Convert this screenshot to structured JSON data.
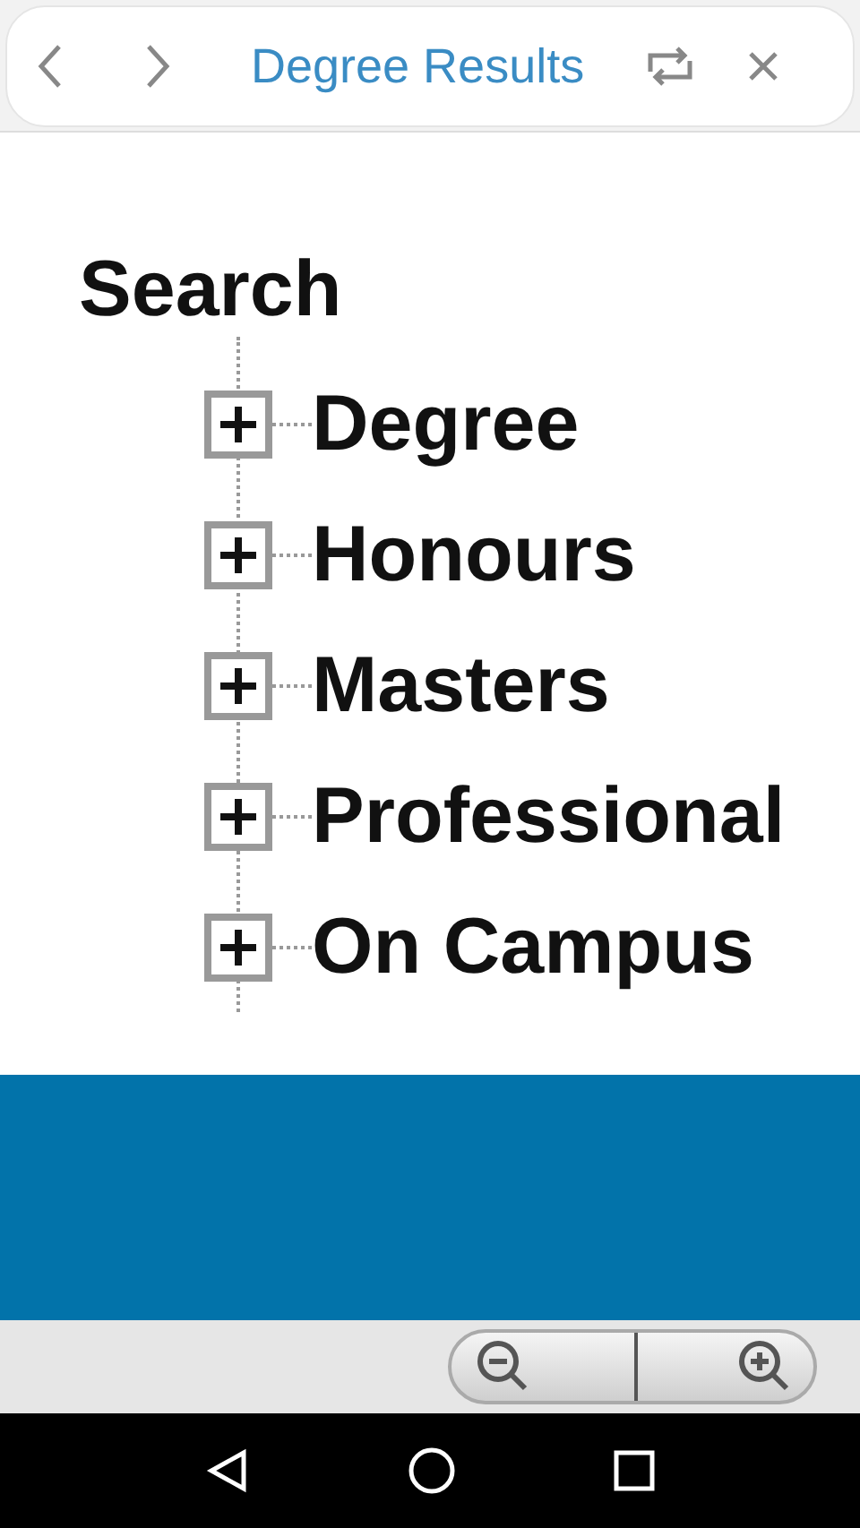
{
  "header": {
    "title": "Degree Results"
  },
  "tree": {
    "label": "Search",
    "children": [
      {
        "label": "Degree",
        "expanded": false
      },
      {
        "label": "Honours",
        "expanded": false
      },
      {
        "label": "Masters",
        "expanded": false
      },
      {
        "label": "Professional",
        "expanded": false
      },
      {
        "label": "On Campus",
        "expanded": false
      }
    ]
  }
}
